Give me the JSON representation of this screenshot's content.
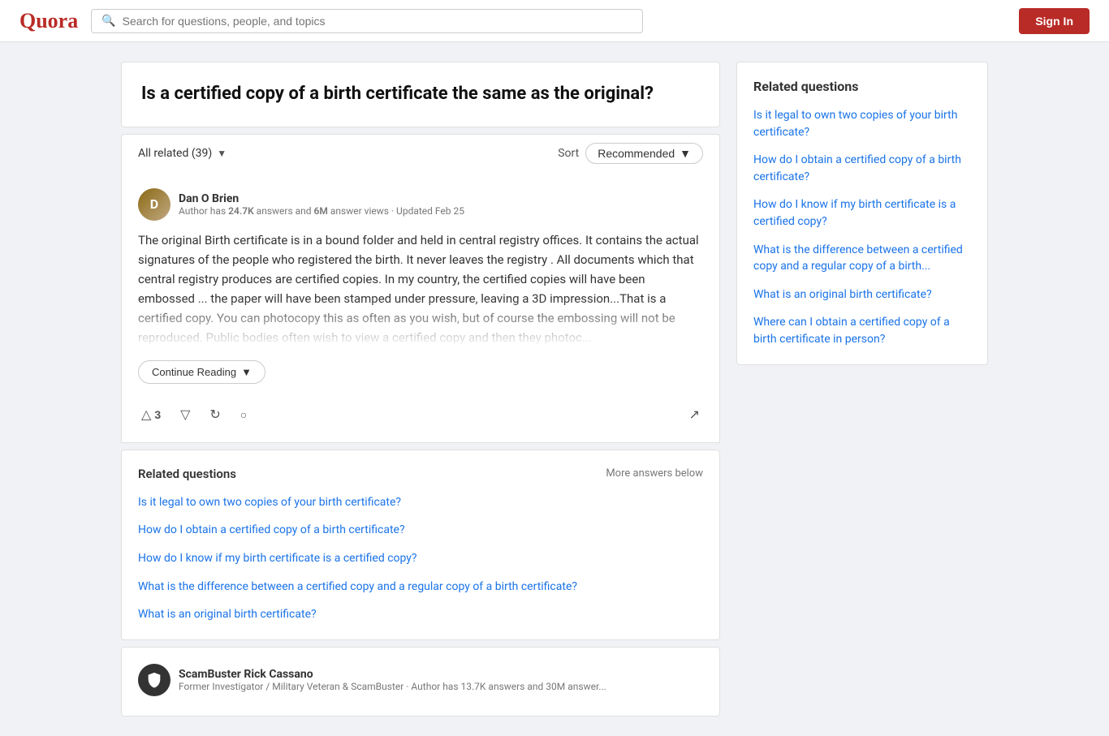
{
  "header": {
    "logo": "Quora",
    "search_placeholder": "Search for questions, people, and topics",
    "sign_in_label": "Sign In"
  },
  "question": {
    "title": "Is a certified copy of a birth certificate the same as the original?"
  },
  "answers_toolbar": {
    "all_related_label": "All related (39)",
    "sort_label": "Sort",
    "sort_value": "Recommended"
  },
  "answer": {
    "author_name": "Dan O Brien",
    "author_meta_prefix": "Author has ",
    "author_answers": "24.7K",
    "author_meta_mid": " answers and ",
    "author_views": "6M",
    "author_meta_suffix": " answer views · Updated Feb 25",
    "text": "The original Birth certificate is in a bound folder and held in central registry offices. It contains the actual signatures of the people who registered the birth. It never leaves the registry . All documents which that central registry produces are certified copies. In my country, the certified copies will have been embossed ... the paper will have been stamped under pressure, leaving a 3D impression...That is a certified copy. You can photocopy this as often as you wish, but of course the embossing will not be reproduced. Public bodies often wish to view a certified copy and then they photoc...",
    "upvote_count": "3",
    "continue_reading": "Continue Reading"
  },
  "related_questions_inline": {
    "title": "Related questions",
    "more_answers_label": "More answers below",
    "items": [
      "Is it legal to own two copies of your birth certificate?",
      "How do I obtain a certified copy of a birth certificate?",
      "How do I know if my birth certificate is a certified copy?",
      "What is the difference between a certified copy and a regular copy of a birth certificate?",
      "What is an original birth certificate?"
    ]
  },
  "second_author": {
    "name": "ScamBuster Rick Cassano",
    "meta": "Former Investigator / Military Veteran & ScamBuster · Author has 13.7K answers and 30M answer..."
  },
  "sidebar": {
    "title": "Related questions",
    "items": [
      "Is it legal to own two copies of your birth certificate?",
      "How do I obtain a certified copy of a birth certificate?",
      "How do I know if my birth certificate is a certified copy?",
      "What is the difference between a certified copy and a regular copy of a birth...",
      "What is an original birth certificate?",
      "Where can I obtain a certified copy of a birth certificate in person?"
    ]
  }
}
